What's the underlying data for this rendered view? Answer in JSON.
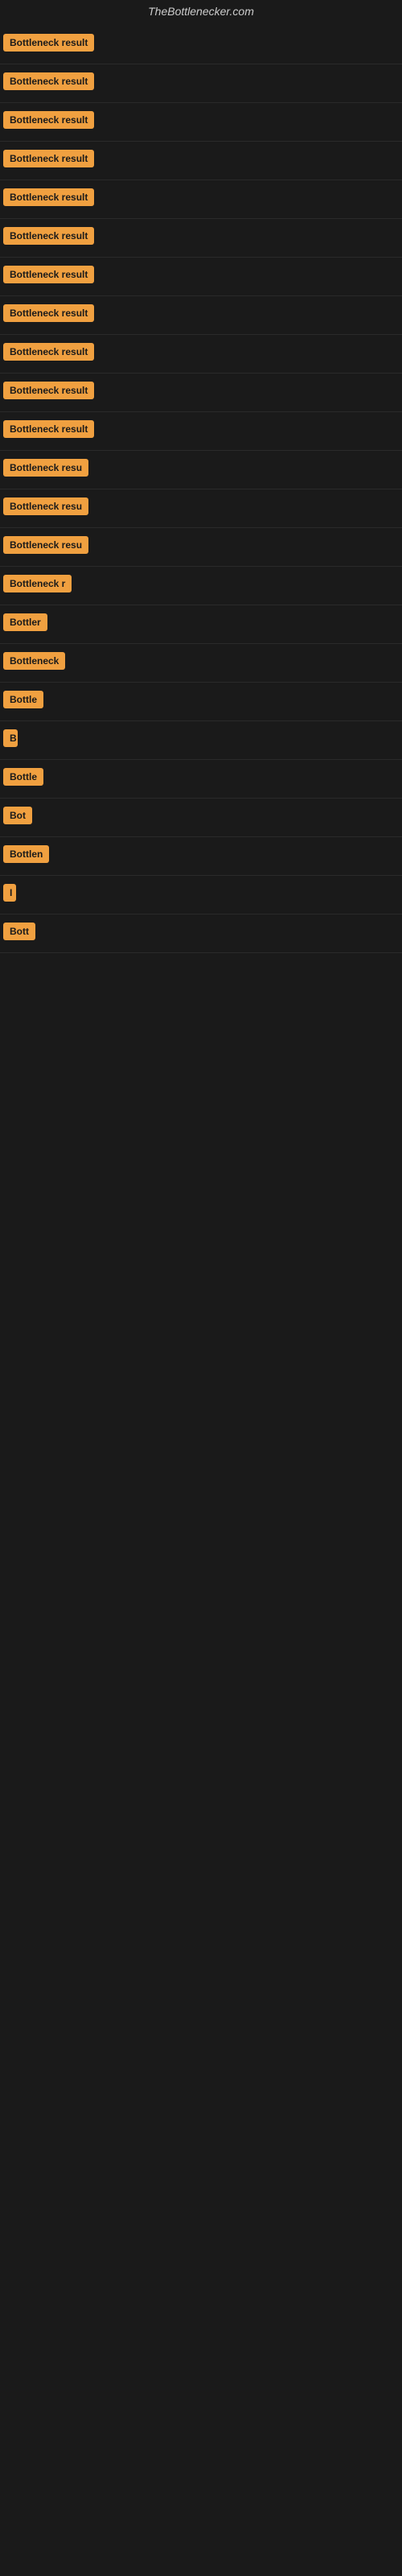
{
  "site": {
    "title": "TheBottlenecker.com"
  },
  "rows": [
    {
      "id": 1,
      "label": "Bottleneck result",
      "width": 130
    },
    {
      "id": 2,
      "label": "Bottleneck result",
      "width": 130
    },
    {
      "id": 3,
      "label": "Bottleneck result",
      "width": 130
    },
    {
      "id": 4,
      "label": "Bottleneck result",
      "width": 130
    },
    {
      "id": 5,
      "label": "Bottleneck result",
      "width": 130
    },
    {
      "id": 6,
      "label": "Bottleneck result",
      "width": 130
    },
    {
      "id": 7,
      "label": "Bottleneck result",
      "width": 130
    },
    {
      "id": 8,
      "label": "Bottleneck result",
      "width": 130
    },
    {
      "id": 9,
      "label": "Bottleneck result",
      "width": 130
    },
    {
      "id": 10,
      "label": "Bottleneck result",
      "width": 130
    },
    {
      "id": 11,
      "label": "Bottleneck result",
      "width": 130
    },
    {
      "id": 12,
      "label": "Bottleneck resu",
      "width": 110
    },
    {
      "id": 13,
      "label": "Bottleneck resu",
      "width": 110
    },
    {
      "id": 14,
      "label": "Bottleneck resu",
      "width": 110
    },
    {
      "id": 15,
      "label": "Bottleneck r",
      "width": 90
    },
    {
      "id": 16,
      "label": "Bottler",
      "width": 60
    },
    {
      "id": 17,
      "label": "Bottleneck",
      "width": 80
    },
    {
      "id": 18,
      "label": "Bottle",
      "width": 55
    },
    {
      "id": 19,
      "label": "B",
      "width": 18
    },
    {
      "id": 20,
      "label": "Bottle",
      "width": 55
    },
    {
      "id": 21,
      "label": "Bot",
      "width": 36
    },
    {
      "id": 22,
      "label": "Bottlen",
      "width": 65
    },
    {
      "id": 23,
      "label": "I",
      "width": 10
    },
    {
      "id": 24,
      "label": "Bott",
      "width": 45
    }
  ]
}
